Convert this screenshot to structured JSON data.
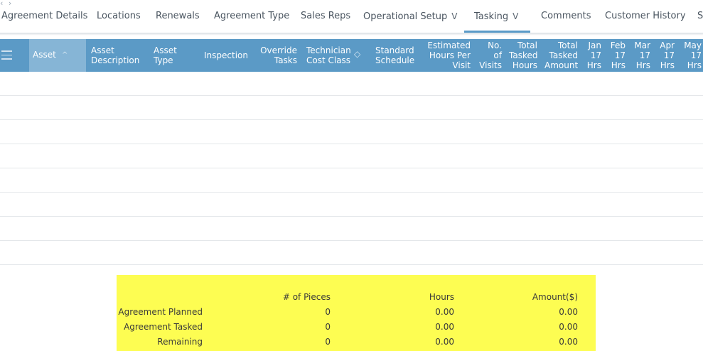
{
  "tabs": [
    {
      "label": "Agreement Details"
    },
    {
      "label": "Locations"
    },
    {
      "label": "Renewals"
    },
    {
      "label": "Agreement Type"
    },
    {
      "label": "Sales Reps"
    },
    {
      "label": "Operational Setup"
    },
    {
      "label": "Tasking"
    },
    {
      "label": "Comments"
    },
    {
      "label": "Customer History"
    },
    {
      "label": "S"
    }
  ],
  "active_tab": "Tasking",
  "columns": {
    "asset": "Asset",
    "asset_description_1": "Asset",
    "asset_description_2": "Description",
    "asset_type_1": "Asset",
    "asset_type_2": "Type",
    "inspection": "Inspection",
    "override_1": "Override",
    "override_2": "Tasks",
    "tech_cost_1": "Technician",
    "tech_cost_2": "Cost Class",
    "standard_1": "Standard",
    "standard_2": "Schedule",
    "est_1": "Estimated",
    "est_2": "Hours Per",
    "est_3": "Visit",
    "visits_1": "No.",
    "visits_2": "of",
    "visits_3": "Visits",
    "total_hours_1": "Total",
    "total_hours_2": "Tasked",
    "total_hours_3": "Hours",
    "total_amount_1": "Total",
    "total_amount_2": "Tasked",
    "total_amount_3": "Amount",
    "jan_1": "Jan",
    "jan_2": "17",
    "jan_3": "Hrs",
    "feb_1": "Feb",
    "feb_2": "17",
    "feb_3": "Hrs",
    "mar_1": "Mar",
    "mar_2": "17",
    "mar_3": "Hrs",
    "apr_1": "Apr",
    "apr_2": "17",
    "apr_3": "Hrs",
    "may_1": "May",
    "may_2": "17",
    "may_3": "Hrs"
  },
  "summary": {
    "headers": {
      "pieces": "# of Pieces",
      "hours": "Hours",
      "amount": "Amount($)"
    },
    "rows": [
      {
        "label": "Agreement Planned",
        "pieces": "0",
        "hours": "0.00",
        "amount": "0.00"
      },
      {
        "label": "Agreement Tasked",
        "pieces": "0",
        "hours": "0.00",
        "amount": "0.00"
      },
      {
        "label": "Remaining",
        "pieces": "0",
        "hours": "0.00",
        "amount": "0.00"
      }
    ]
  },
  "icons": {
    "scroll_left": "‹",
    "scroll_right": "›",
    "sort_asc": "^",
    "sort_toggle": "◇",
    "dropdown": "V"
  },
  "colors": {
    "header_bg": "#5b9ac6",
    "sorted_col_bg": "#86b5d6",
    "summary_bg": "#fdfd52",
    "tab_underline": "#5a9ac8"
  }
}
